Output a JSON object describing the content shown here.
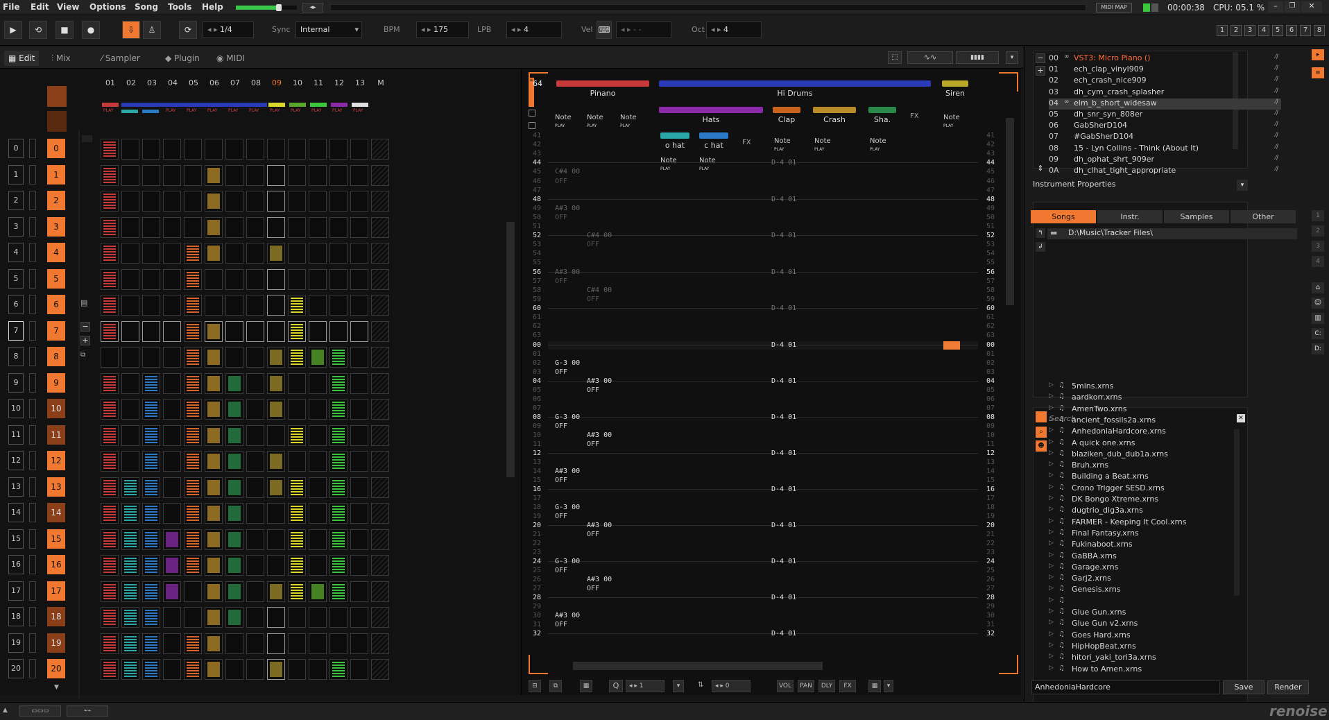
{
  "menu": [
    "File",
    "Edit",
    "View",
    "Options",
    "Song",
    "Tools",
    "Help"
  ],
  "topright": {
    "midi_map": "MIDI MAP",
    "time": "00:00:38",
    "cpu": "CPU: 05.1 %"
  },
  "toolbar": {
    "lines": "1/4",
    "sync_label": "Sync",
    "sync_value": "Internal",
    "bpm_label": "BPM",
    "bpm": "175",
    "lpb_label": "LPB",
    "lpb": "4",
    "vel_label": "Vel",
    "vel": "- -",
    "oct_label": "Oct",
    "oct": "4",
    "tracks": [
      "1",
      "2",
      "3",
      "4",
      "5",
      "6",
      "7",
      "8"
    ]
  },
  "tabs": [
    "Edit",
    "Mix",
    "Sampler",
    "Plugin",
    "MIDI"
  ],
  "matrix": {
    "columns": [
      "01",
      "02",
      "03",
      "04",
      "05",
      "06",
      "07",
      "08",
      "09",
      "10",
      "11",
      "12",
      "13",
      "M"
    ],
    "rows": [
      "0",
      "1",
      "2",
      "3",
      "4",
      "5",
      "6",
      "7",
      "8",
      "9",
      "10",
      "11",
      "12",
      "13",
      "14",
      "15",
      "16",
      "17",
      "18",
      "19",
      "20"
    ],
    "play": "PLAY",
    "colors": {
      "red": "#c83a3a",
      "cyan": "#2aa8a8",
      "blue": "#2a7ac8",
      "purple": "#8a2aa8",
      "orange": "#d8642a",
      "tan": "#b88a28",
      "green": "#2a8a4a",
      "olive": "#a08a2a",
      "yellow": "#d8d82a",
      "lime": "#5aa82a",
      "brightgreen": "#3ac83a"
    }
  },
  "pattern": {
    "num": "64",
    "tracks": {
      "piano": "Pinano",
      "hidrums": "Hi Drums",
      "hats": "Hats",
      "ohat": "o hat",
      "chat": "c hat",
      "clap": "Clap",
      "crash": "Crash",
      "sha": "Sha.",
      "siren": "Siren"
    },
    "note": "Note",
    "play": "PLAY",
    "fx": "FX",
    "off": "OFF",
    "rows_top": [
      "41",
      "42",
      "43",
      "44",
      "45",
      "46",
      "47",
      "48",
      "49",
      "50",
      "51",
      "52",
      "53",
      "54",
      "55",
      "56",
      "57",
      "58",
      "59",
      "60",
      "61",
      "62",
      "63"
    ],
    "rows_main": [
      "00",
      "01",
      "02",
      "03",
      "04",
      "05",
      "06",
      "07",
      "08",
      "09",
      "10",
      "11",
      "12",
      "13",
      "14",
      "15",
      "16",
      "17",
      "18",
      "19",
      "20",
      "21",
      "22",
      "23",
      "24",
      "25",
      "26",
      "27",
      "28",
      "29",
      "30",
      "31",
      "32"
    ],
    "drum_note": "D-4 01",
    "notes": [
      {
        "row": "45",
        "col": 1,
        "v": "C#4 00"
      },
      {
        "row": "49",
        "col": 1,
        "v": "A#3 00"
      },
      {
        "row": "52",
        "col": 2,
        "v": "C#4 00"
      },
      {
        "row": "56",
        "col": 1,
        "v": "A#3 00"
      },
      {
        "row": "58",
        "col": 2,
        "v": "C#4 00"
      },
      {
        "row": "02",
        "col": 1,
        "v": "G-3 00"
      },
      {
        "row": "04",
        "col": 2,
        "v": "A#3 00"
      },
      {
        "row": "08",
        "col": 1,
        "v": "G-3 00"
      },
      {
        "row": "10",
        "col": 2,
        "v": "A#3 00"
      },
      {
        "row": "14",
        "col": 1,
        "v": "A#3 00"
      },
      {
        "row": "18",
        "col": 1,
        "v": "G-3 00"
      },
      {
        "row": "20",
        "col": 2,
        "v": "A#3 00"
      },
      {
        "row": "24",
        "col": 1,
        "v": "G-3 00"
      },
      {
        "row": "26",
        "col": 2,
        "v": "A#3 00"
      },
      {
        "row": "30",
        "col": 1,
        "v": "A#3 00"
      }
    ]
  },
  "bottom_pattern": {
    "q": "Q",
    "step": "1",
    "num": "0",
    "vol": "VOL",
    "pan": "PAN",
    "dly": "DLY",
    "fx": "FX"
  },
  "instruments": [
    {
      "n": "00",
      "name": "VST3: Micro Piano ()",
      "hl": true
    },
    {
      "n": "01",
      "name": "ech_clap_vinyl909"
    },
    {
      "n": "02",
      "name": "ech_crash_nice909"
    },
    {
      "n": "03",
      "name": "dh_cym_crash_splasher"
    },
    {
      "n": "04",
      "name": "elm_b_short_widesaw",
      "sel": true
    },
    {
      "n": "05",
      "name": "dh_snr_syn_808er"
    },
    {
      "n": "06",
      "name": "GabSherD104"
    },
    {
      "n": "07",
      "name": "#GabSherD104"
    },
    {
      "n": "08",
      "name": "15 - Lyn Collins - Think (About It)"
    },
    {
      "n": "09",
      "name": "dh_ophat_shrt_909er"
    },
    {
      "n": "0A",
      "name": "dh_clhat_tight_appropriate"
    }
  ],
  "instrument_props": "Instrument Properties",
  "browser_tabs": [
    "Songs",
    "Instr.",
    "Samples",
    "Other"
  ],
  "path": "D:\\Music\\Tracker Files\\",
  "search_label": "Search",
  "files": [
    "5mins.xrns",
    "aardkorr.xrns",
    "AmenTwo.xrns",
    "ancient_fossils2a.xrns",
    "AnhedoniaHardcore.xrns",
    "A quick one.xrns",
    "blaziken_dub_dub1a.xrns",
    "Bruh.xrns",
    "Building a Beat.xrns",
    "Crono Trigger SESD.xrns",
    "DK Bongo Xtreme.xrns",
    "dugtrio_dig3a.xrns",
    "FARMER - Keeping It Cool.xrns",
    "Final Fantasy.xrns",
    "Fukinaboot.xrns",
    "GaBBA.xrns",
    "Garage.xrns",
    "Garj2.xrns",
    "Genesis.xrns",
    "",
    "Glue Gun.xrns",
    "Glue Gun v2.xrns",
    "Goes Hard.xrns",
    "HipHopBeat.xrns",
    "hitori_yaki_tori3a.xrns",
    "How to Amen.xrns"
  ],
  "filename": "AnhedoniaHardcore",
  "save": "Save",
  "render": "Render",
  "logo": "renoise"
}
